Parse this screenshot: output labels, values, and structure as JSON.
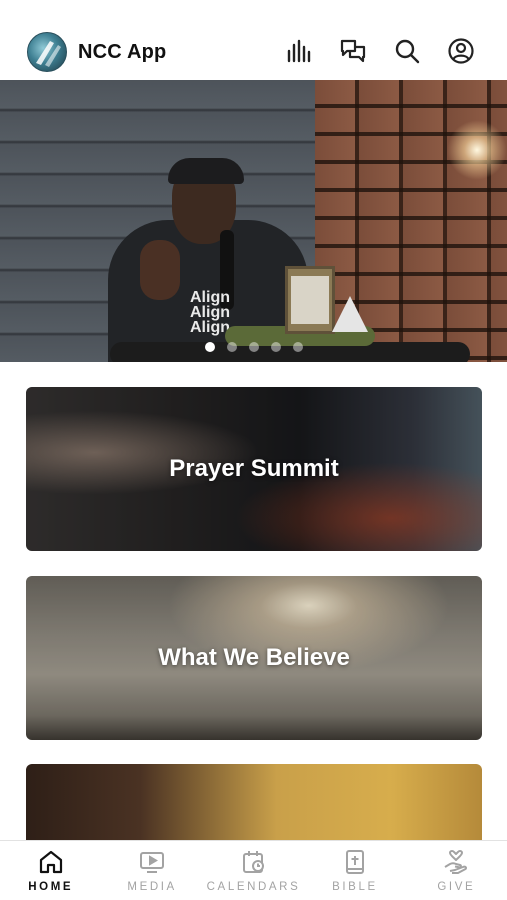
{
  "header": {
    "app_title": "NCC App",
    "icons": [
      "audio-bars-icon",
      "chat-icon",
      "search-icon",
      "profile-icon"
    ]
  },
  "hero": {
    "shirt_text": [
      "Align",
      "Align",
      "Align"
    ],
    "slides_total": 5,
    "active_slide": 1
  },
  "cards": [
    {
      "title": "Prayer Summit"
    },
    {
      "title": "What We Believe"
    },
    {
      "title": ""
    }
  ],
  "tabs": [
    {
      "label": "HOME",
      "icon": "home-icon",
      "active": true
    },
    {
      "label": "MEDIA",
      "icon": "media-icon",
      "active": false
    },
    {
      "label": "CALENDARS",
      "icon": "calendar-icon",
      "active": false
    },
    {
      "label": "BIBLE",
      "icon": "bible-icon",
      "active": false
    },
    {
      "label": "GIVE",
      "icon": "give-icon",
      "active": false
    }
  ],
  "colors": {
    "active_tab": "#111111",
    "inactive_tab": "#a3a3a3",
    "dot_active": "#ffffff"
  }
}
